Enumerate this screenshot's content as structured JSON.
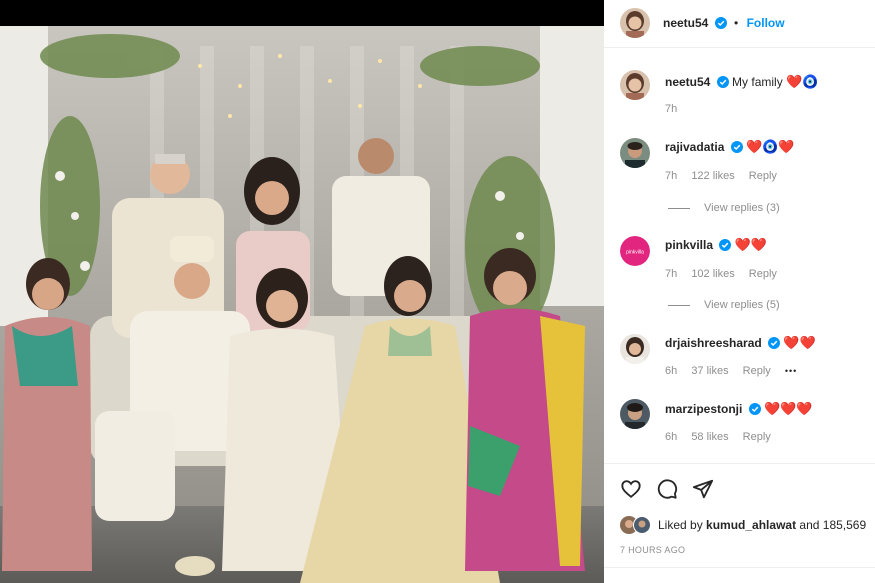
{
  "post": {
    "author": "neetu54",
    "follow_label": "Follow",
    "caption": {
      "username": "neetu54",
      "text": "My family",
      "emoji": "❤️🧿",
      "time": "7h"
    }
  },
  "comments": [
    {
      "username": "rajivadatia",
      "text": "❤️🧿❤️",
      "time": "7h",
      "likes": "122 likes",
      "reply": "Reply",
      "view_replies": "View replies (3)"
    },
    {
      "username": "pinkvilla",
      "text": "❤️❤️",
      "time": "7h",
      "likes": "102 likes",
      "reply": "Reply",
      "view_replies": "View replies (5)"
    },
    {
      "username": "drjaishreesharad",
      "text": "❤️❤️",
      "time": "6h",
      "likes": "37 likes",
      "reply": "Reply",
      "more": "•••"
    },
    {
      "username": "marzipestonji",
      "text": "❤️❤️❤️",
      "time": "6h",
      "likes": "58 likes",
      "reply": "Reply"
    }
  ],
  "likes": {
    "prefix": "Liked by",
    "user": "kumud_ahlawat",
    "rest": "and 185,569"
  },
  "posted_ago": "7 HOURS AGO",
  "icons": [
    "heart-outline-icon",
    "comment-icon",
    "share-icon",
    "verified-badge-icon"
  ],
  "colors": {
    "link_blue": "#0095f6",
    "verified_blue": "#0095f6",
    "heart_red": "#e0152b",
    "muted": "#8e8e8e"
  }
}
